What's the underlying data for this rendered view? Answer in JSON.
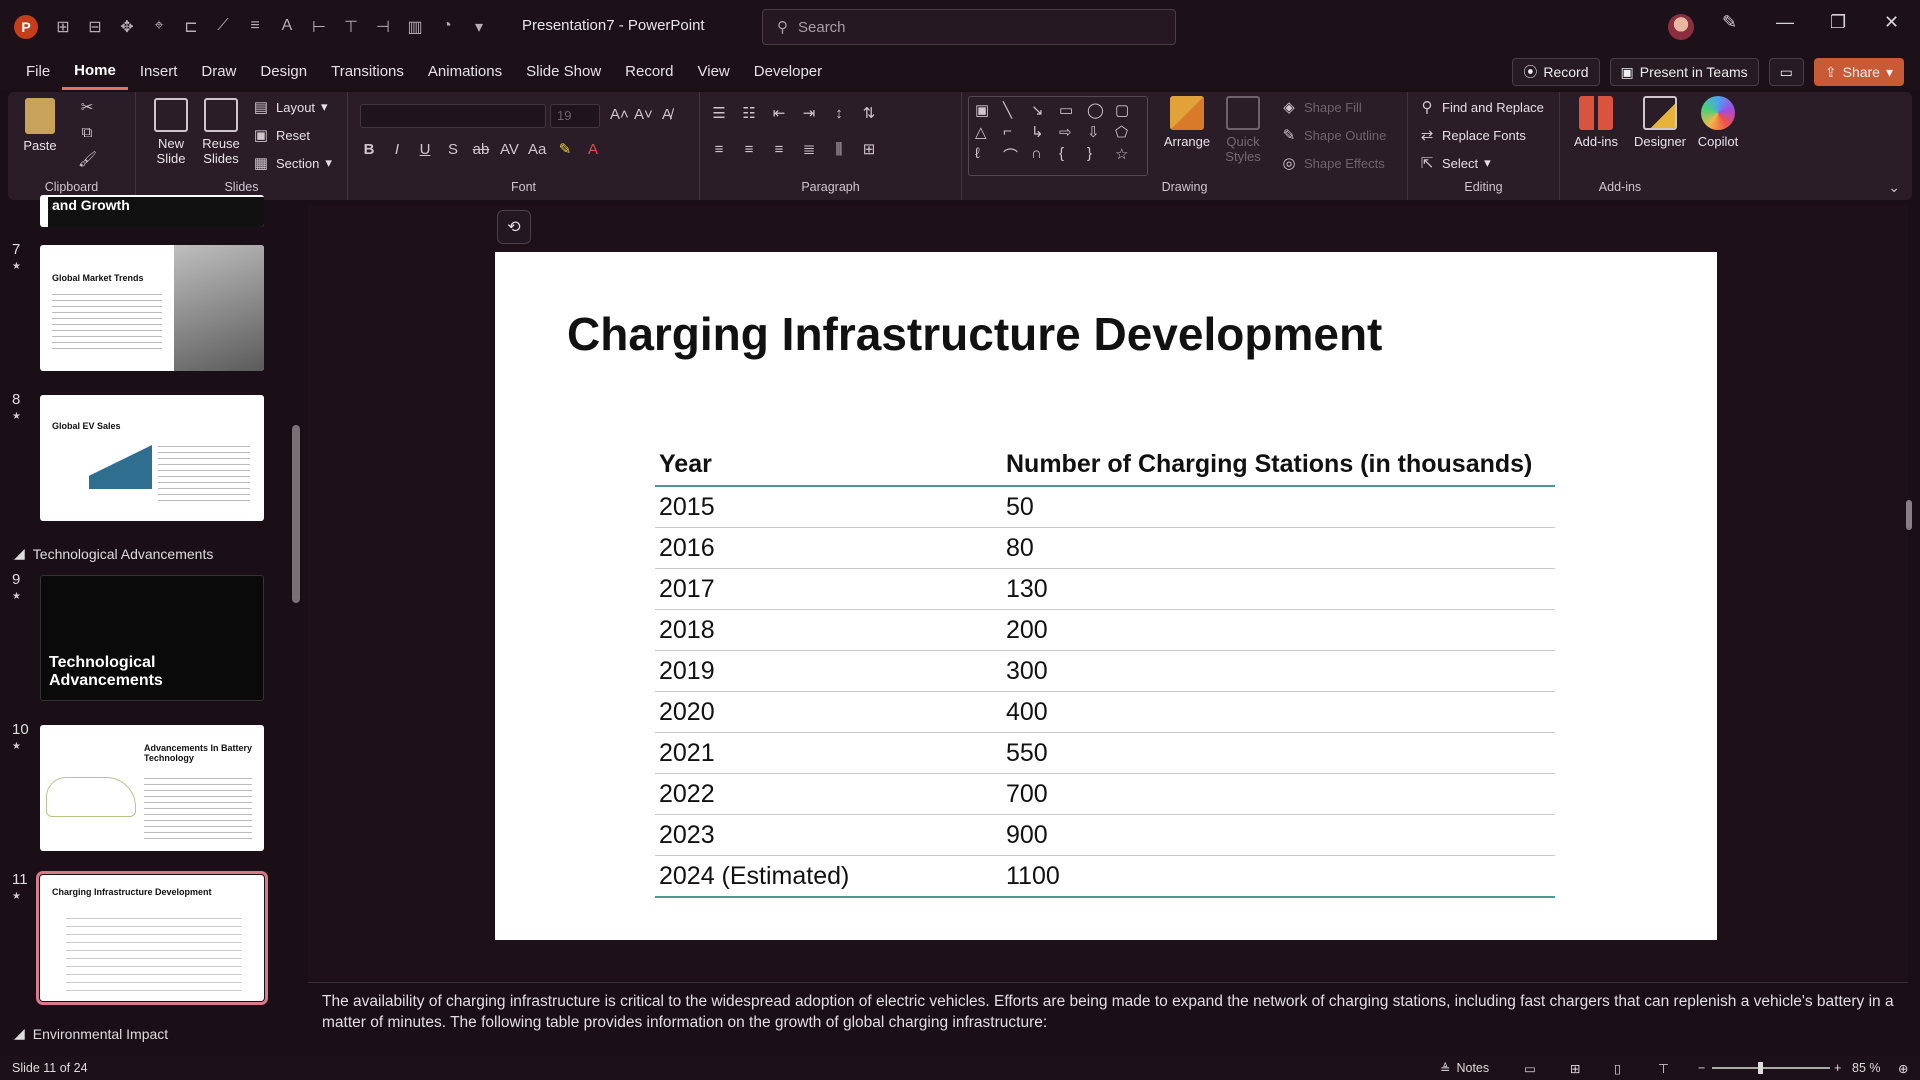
{
  "titlebar": {
    "app_letter": "P",
    "doc_title": "Presentation7  -  PowerPoint",
    "search_placeholder": "Search"
  },
  "menu": {
    "tabs": [
      "File",
      "Home",
      "Insert",
      "Draw",
      "Design",
      "Transitions",
      "Animations",
      "Slide Show",
      "Record",
      "View",
      "Developer"
    ],
    "active_tab": "Home",
    "record_label": "Record",
    "present_label": "Present in Teams",
    "share_label": "Share"
  },
  "ribbon": {
    "clipboard": {
      "paste": "Paste",
      "label": "Clipboard"
    },
    "slides": {
      "new_slide": "New Slide",
      "reuse_slides": "Reuse Slides",
      "layout": "Layout",
      "reset": "Reset",
      "section": "Section",
      "label": "Slides"
    },
    "font": {
      "size": "19",
      "label": "Font"
    },
    "paragraph": {
      "label": "Paragraph"
    },
    "drawing": {
      "arrange": "Arrange",
      "quick_styles": "Quick Styles",
      "shape_fill": "Shape Fill",
      "shape_outline": "Shape Outline",
      "shape_effects": "Shape Effects",
      "label": "Drawing"
    },
    "editing": {
      "find_replace": "Find and Replace",
      "replace_fonts": "Replace Fonts",
      "select": "Select",
      "label": "Editing"
    },
    "addins": {
      "addins": "Add-ins",
      "designer": "Designer",
      "copilot": "Copilot",
      "label": "Add-ins"
    }
  },
  "thumbnails": {
    "top_partial_title": "and Growth",
    "items": [
      {
        "num": "7",
        "title": "Global Market Trends"
      },
      {
        "num": "8",
        "title": "Global EV Sales"
      },
      {
        "num": "9",
        "title": "Technological Advancements"
      },
      {
        "num": "10",
        "title": "Advancements In Battery Technology"
      },
      {
        "num": "11",
        "title": "Charging Infrastructure Development"
      }
    ],
    "sections": [
      "Technological Advancements",
      "Environmental Impact"
    ]
  },
  "slide": {
    "title": "Charging Infrastructure Development",
    "table": {
      "headers": [
        "Year",
        "Number of Charging Stations (in thousands)"
      ],
      "rows": [
        [
          "2015",
          "50"
        ],
        [
          "2016",
          "80"
        ],
        [
          "2017",
          "130"
        ],
        [
          "2018",
          "200"
        ],
        [
          "2019",
          "300"
        ],
        [
          "2020",
          "400"
        ],
        [
          "2021",
          "550"
        ],
        [
          "2022",
          "700"
        ],
        [
          "2023",
          "900"
        ],
        [
          "2024 (Estimated)",
          "1100"
        ]
      ]
    }
  },
  "notes_text": "The availability of charging infrastructure is critical to the widespread adoption of electric vehicles. Efforts are being made to expand the network of charging stations, including fast chargers that can replenish a vehicle's battery in a matter of minutes. The following table provides information on the growth of global charging infrastructure:",
  "status": {
    "slide_info": "Slide 11 of 24",
    "notes_label": "Notes",
    "zoom": "85 %"
  },
  "colors": {
    "accent": "#e2745a",
    "table_rule": "#4b9a8f",
    "selected_thumb": "#d77a8a",
    "share_button": "#c85a36"
  }
}
